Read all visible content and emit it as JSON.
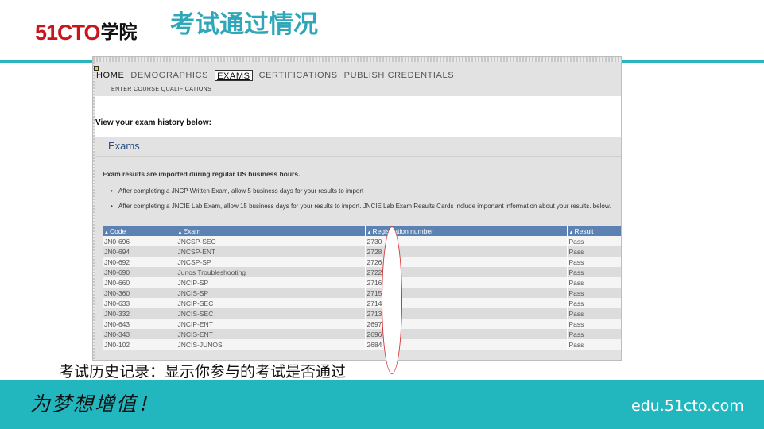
{
  "brand": {
    "logo_number": "51CTO",
    "logo_name": "学院"
  },
  "slide": {
    "title": "考试通过情况",
    "caption": "考试历史记录：显示你参与的考试是否通过",
    "slogan": "为梦想增值！",
    "website": "edu.51cto.com"
  },
  "screenshot": {
    "nav": {
      "home": "HOME",
      "demographics": "DEMOGRAPHICS",
      "exams": "EXAMS",
      "certifications": "CERTIFICATIONS",
      "publish": "PUBLISH CREDENTIALS"
    },
    "subnav": "ENTER COURSE QUALIFICATIONS",
    "history_label": "View your exam history below:",
    "section_title": "Exams",
    "import_note": "Exam results are imported during regular US business hours.",
    "bullets": [
      "After completing a JNCP Written Exam, allow 5 business days for your results to import",
      "After completing a JNCIE Lab Exam, allow 15 business days for your results to import. JNCIE Lab Exam Results Cards include important information about your results. below."
    ],
    "columns": [
      "Code",
      "Exam",
      "Registration number",
      "Result"
    ],
    "rows": [
      [
        "JN0-696",
        "JNCSP-SEC",
        "2730",
        "Pass"
      ],
      [
        "JN0-694",
        "JNCSP-ENT",
        "2728",
        "Pass"
      ],
      [
        "JN0-692",
        "JNCSP-SP",
        "2726",
        "Pass"
      ],
      [
        "JN0-690",
        "Junos Troubleshooting",
        "2722",
        "Pass"
      ],
      [
        "JN0-660",
        "JNCIP-SP",
        "2716",
        "Pass"
      ],
      [
        "JN0-360",
        "JNCIS-SP",
        "2715",
        "Pass"
      ],
      [
        "JN0-633",
        "JNCIP-SEC",
        "2714",
        "Pass"
      ],
      [
        "JN0-332",
        "JNCIS-SEC",
        "2713",
        "Pass"
      ],
      [
        "JN0-643",
        "JNCIP-ENT",
        "2697",
        "Pass"
      ],
      [
        "JN0-343",
        "JNCIS-ENT",
        "2696",
        "Pass"
      ],
      [
        "JN0-102",
        "JNCIS-JUNOS",
        "2684",
        "Pass"
      ]
    ]
  },
  "colors": {
    "accent": "#2ab4c0",
    "title": "#2fa7b9",
    "logo_red": "#c8161d",
    "table_header": "#5b82b2",
    "footer": "#22b6be"
  }
}
